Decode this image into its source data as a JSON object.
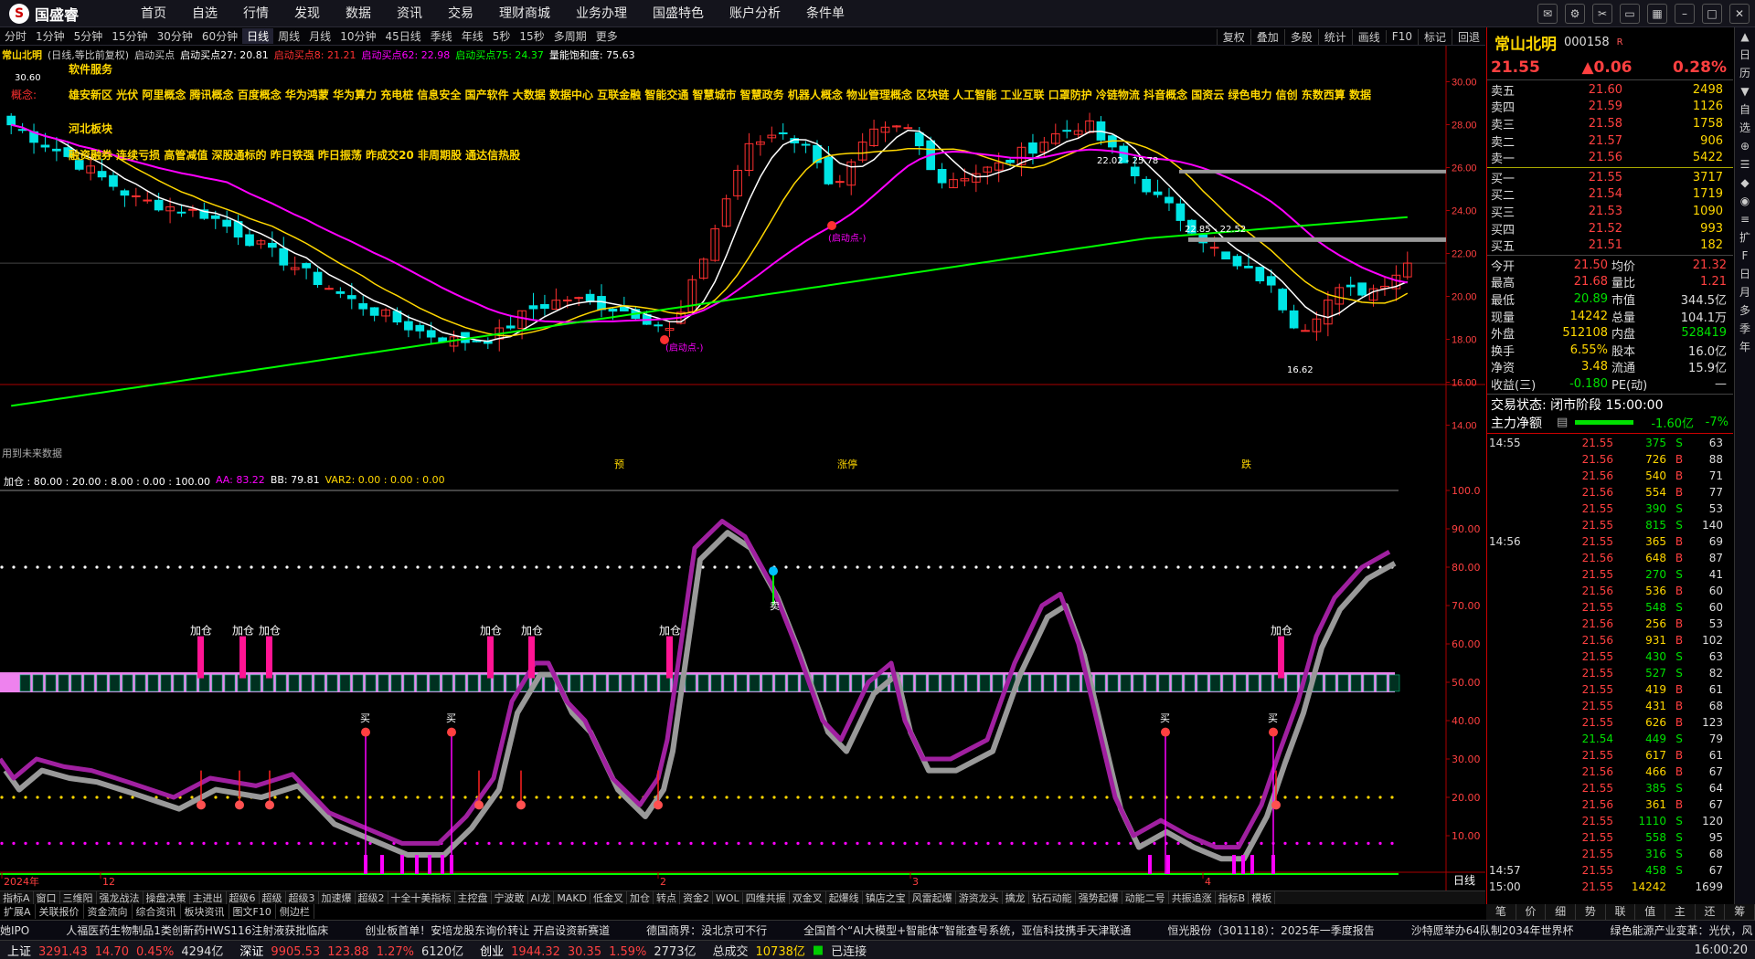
{
  "topbar": {
    "logo": "国盛睿",
    "menu": [
      "首页",
      "自选",
      "行情",
      "发现",
      "数据",
      "资讯",
      "交易",
      "理财商城",
      "业务办理",
      "国盛特色",
      "账户分析",
      "条件单"
    ]
  },
  "periods": [
    "分时",
    "1分钟",
    "5分钟",
    "15分钟",
    "30分钟",
    "60分钟",
    "日线",
    "周线",
    "月线",
    "10分钟",
    "45日线",
    "季线",
    "年线",
    "5秒",
    "15秒",
    "多周期",
    "更多"
  ],
  "active_period": "日线",
  "chart_tools": [
    "复权",
    "叠加",
    "多股",
    "统计",
    "画线",
    "F10",
    "标记",
    "回退"
  ],
  "stock": {
    "name": "常山北明",
    "code": "000158",
    "mode": "(日线,等比前复权)",
    "indicator": "启动买点"
  },
  "legend_main": [
    {
      "label": "启动买点27: 20.81",
      "color": "#ffffff"
    },
    {
      "label": "启动买点8: 21.21",
      "color": "#ff3030"
    },
    {
      "label": "启动买点62: 22.98",
      "color": "#ff00ff"
    },
    {
      "label": "启动买点75: 24.37",
      "color": "#00ff00"
    },
    {
      "label": "量能饱和度: 75.63",
      "color": "#ffffff"
    }
  ],
  "concepts": {
    "l1": "软件服务",
    "l2_label": "概念:",
    "l2": "雄安新区 光伏 阿里概念 腾讯概念 百度概念 华为鸿蒙 华为算力 充电桩 信息安全 国产软件 大数据 数据中心 互联金融 智能交通 智慧城市 智慧政务 机器人概念 物业管理概念 区块链 人工智能 工业互联 口罩防护 冷链物流 抖音概念 国资云 绿色电力 信创 东数西算 数据",
    "l3": "河北板块",
    "l4": "融资融券 连续亏损 高管减值 深股通标的 昨日铁强 昨日振荡 昨成交20 非周期股 通达信热股"
  },
  "price_axis": [
    "30.00",
    "28.00",
    "26.00",
    "24.00",
    "22.00",
    "20.00",
    "18.00",
    "16.00",
    "14.00"
  ],
  "price_annots": [
    "30.60",
    "22.02 - 25.78",
    "22.85 - 22.52",
    "16.62",
    "(启动点-)",
    "(启动点-)"
  ],
  "no_data": "用到未来数据",
  "bottom_marks": [
    "预",
    "涨停",
    "跌"
  ],
  "legend_sub": [
    {
      "label": "加仓 : 80.00 : 20.00 : 8.00 : 0.00 : 100.00",
      "color": "#ffffff"
    },
    {
      "label": "AA: 83.22",
      "color": "#ff00ff"
    },
    {
      "label": "BB: 79.81",
      "color": "#ffffff"
    },
    {
      "label": "VAR2: 0.00 : 0.00 : 0.00",
      "color": "#ffd700"
    }
  ],
  "sub_axis": [
    "100.0",
    "90.00",
    "80.00",
    "70.00",
    "60.00",
    "50.00",
    "40.00",
    "30.00",
    "20.00",
    "10.00"
  ],
  "sub_texts": {
    "add": "加仓",
    "buy": "买",
    "sell": "卖"
  },
  "date_axis": [
    "2024年",
    "12",
    "2",
    "3",
    "4"
  ],
  "axis_mode": "日线",
  "quote": {
    "price": "21.55",
    "change": "▲0.06",
    "pct": "0.28%",
    "asks": [
      [
        "卖五",
        "21.60",
        "2498"
      ],
      [
        "卖四",
        "21.59",
        "1126"
      ],
      [
        "卖三",
        "21.58",
        "1758"
      ],
      [
        "卖二",
        "21.57",
        "906"
      ],
      [
        "卖一",
        "21.56",
        "5422"
      ]
    ],
    "bids": [
      [
        "买一",
        "21.55",
        "3717"
      ],
      [
        "买二",
        "21.54",
        "1719"
      ],
      [
        "买三",
        "21.53",
        "1090"
      ],
      [
        "买四",
        "21.52",
        "993"
      ],
      [
        "买五",
        "21.51",
        "182"
      ]
    ],
    "stats": [
      [
        "今开",
        "21.50",
        "均价",
        "21.32"
      ],
      [
        "最高",
        "21.68",
        "量比",
        "1.21"
      ],
      [
        "最低",
        "20.89",
        "市值",
        "344.5亿"
      ],
      [
        "现量",
        "14242",
        "总量",
        "104.1万"
      ],
      [
        "外盘",
        "512108",
        "内盘",
        "528419"
      ],
      [
        "换手",
        "6.55%",
        "股本",
        "16.0亿"
      ],
      [
        "净资",
        "3.48",
        "流通",
        "15.9亿"
      ],
      [
        "收益(三)",
        "-0.180",
        "PE(动)",
        "—"
      ]
    ],
    "trade_status": "交易状态: 闭市阶段 15:00:00",
    "main_flow_label": "主力净额",
    "main_flow_value": "-1.60亿",
    "main_flow_pct": "-7%"
  },
  "ticks": [
    [
      "14:55",
      "21.55",
      "375",
      "S",
      "63"
    ],
    [
      "",
      "21.56",
      "726",
      "B",
      "88"
    ],
    [
      "",
      "21.56",
      "540",
      "B",
      "71"
    ],
    [
      "",
      "21.56",
      "554",
      "B",
      "77"
    ],
    [
      "",
      "21.55",
      "390",
      "S",
      "53"
    ],
    [
      "",
      "21.55",
      "815",
      "S",
      "140"
    ],
    [
      "14:56",
      "21.55",
      "365",
      "B",
      "69"
    ],
    [
      "",
      "21.56",
      "648",
      "B",
      "87"
    ],
    [
      "",
      "21.55",
      "270",
      "S",
      "41"
    ],
    [
      "",
      "21.56",
      "536",
      "B",
      "60"
    ],
    [
      "",
      "21.55",
      "548",
      "S",
      "60"
    ],
    [
      "",
      "21.56",
      "256",
      "B",
      "53"
    ],
    [
      "",
      "21.56",
      "931",
      "B",
      "102"
    ],
    [
      "",
      "21.55",
      "430",
      "S",
      "63"
    ],
    [
      "",
      "21.55",
      "527",
      "S",
      "82"
    ],
    [
      "",
      "21.55",
      "419",
      "B",
      "61"
    ],
    [
      "",
      "21.55",
      "431",
      "B",
      "68"
    ],
    [
      "",
      "21.55",
      "626",
      "B",
      "123"
    ],
    [
      "",
      "21.54",
      "449",
      "S",
      "79"
    ],
    [
      "",
      "21.55",
      "617",
      "B",
      "61"
    ],
    [
      "",
      "21.56",
      "466",
      "B",
      "67"
    ],
    [
      "",
      "21.55",
      "385",
      "S",
      "64"
    ],
    [
      "",
      "21.56",
      "361",
      "B",
      "67"
    ],
    [
      "",
      "21.55",
      "1110",
      "S",
      "120"
    ],
    [
      "",
      "21.55",
      "558",
      "S",
      "95"
    ],
    [
      "",
      "21.55",
      "316",
      "S",
      "68"
    ],
    [
      "14:57",
      "21.55",
      "458",
      "S",
      "67"
    ],
    [
      "15:00",
      "21.55",
      "14242",
      "",
      "1699"
    ]
  ],
  "side_strip": [
    "▲",
    "日",
    "历",
    "▼",
    "自",
    "选",
    "⊕",
    "☰",
    "◆",
    "◉",
    "≡",
    "扩",
    "F",
    "日",
    "月",
    "多",
    "季",
    "年"
  ],
  "tabs_row1": [
    "指标A",
    "窗口",
    "三维阳",
    "强龙战法",
    "操盘决策",
    "主进出",
    "超级6",
    "超级",
    "超级3",
    "加速爆",
    "超级2",
    "十全十美指标",
    "主控盘",
    "宁波敢",
    "AI龙",
    "MAKD",
    "低金叉",
    "加仓",
    "转点",
    "资金2",
    "WOL",
    "四维共振",
    "双金叉",
    "起爆线",
    "镇店之宝",
    "风雷起爆",
    "游资龙头",
    "擒龙",
    "钻石动能",
    "强势起爆",
    "动能二号",
    "共振追涨",
    "指标B",
    "模板"
  ],
  "tabs_row2": [
    "扩展A",
    "关联报价",
    "资金流向",
    "综合资讯",
    "板块资讯",
    "图文F10",
    "侧边栏"
  ],
  "right_tabs": [
    "笔",
    "价",
    "细",
    "势",
    "联",
    "值",
    "主",
    "还",
    "筹"
  ],
  "news": [
    "她IPO",
    "人福医药生物制品1类创新药HWS116注射液获批临床",
    "创业板首单！安培龙股东询价转让 开启设资新赛道",
    "德国商界：没北京可不行",
    "全国首个“AI大模型+智能体”智能查号系统，亚信科技携手天津联通",
    "恒光股份（301118）：2025年一季度报告",
    "沙特愿举办64队制2034年世界杯",
    "绿色能源产业变革：光伏，风"
  ],
  "status": [
    {
      "label": "上证",
      "value": "3291.43",
      "chg": "14.70",
      "pct": "0.45%",
      "amt": "4294亿"
    },
    {
      "label": "深证",
      "value": "9905.53",
      "chg": "123.88",
      "pct": "1.27%",
      "amt": "6120亿"
    },
    {
      "label": "创业",
      "value": "1944.32",
      "chg": "30.35",
      "pct": "1.59%",
      "amt": "2773亿"
    }
  ],
  "status_total": "总成交",
  "status_total_val": "10738亿",
  "status_conn": "已连接",
  "clock": "16:00:20",
  "colors": {
    "up": "#ff3030",
    "down": "#00e5e5",
    "ma5": "#ffffff",
    "ma10": "#ffd700",
    "ma20": "#ff00ff",
    "ma60": "#00ff00",
    "purple": "#a020a0"
  }
}
